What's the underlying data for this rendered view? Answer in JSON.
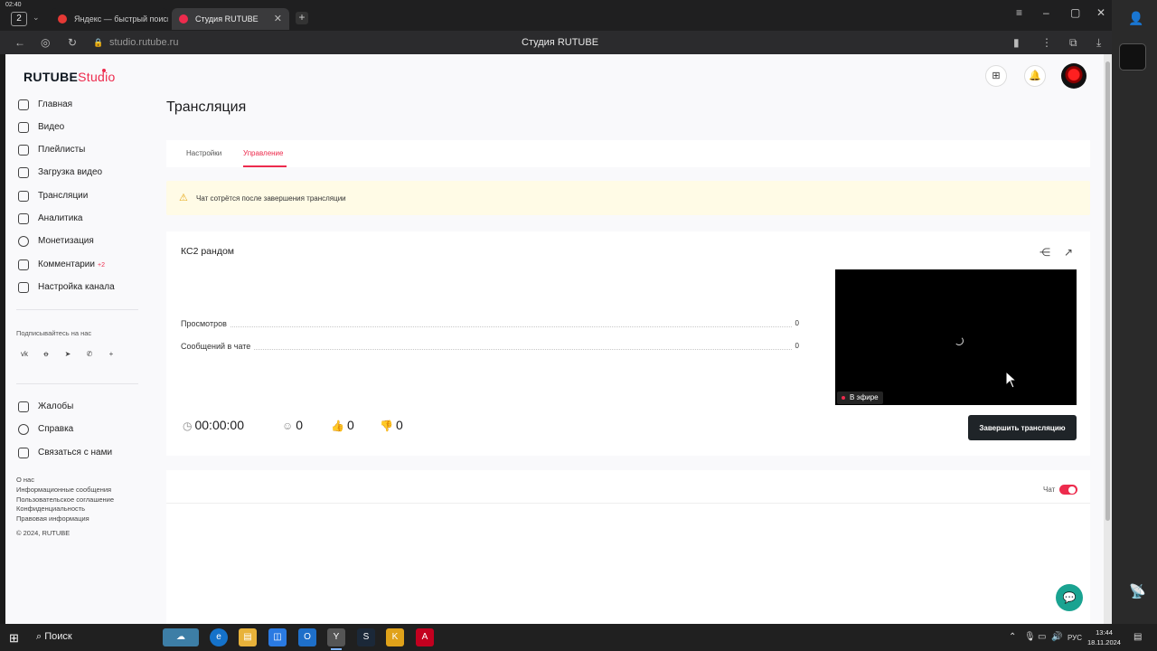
{
  "browser": {
    "recording_time": "02:40",
    "tab_count": "2",
    "tabs": [
      {
        "title": "Яндекс — быстрый поиск",
        "favicon_color": "#e53935"
      },
      {
        "title": "Студия RUTUBE",
        "favicon_color": "#ed2b4d"
      }
    ],
    "new_tab": "+",
    "url": "studio.rutube.ru",
    "page_title": "Студия RUTUBE",
    "nav_icons": [
      "back-icon",
      "shield-icon",
      "reload-icon",
      "lock-icon"
    ],
    "window_controls": [
      "menu-icon",
      "minimize-icon",
      "maximize-icon",
      "close-icon"
    ],
    "toolbar_icons": [
      "bookmark-icon",
      "more-icon",
      "collections-icon",
      "download-icon"
    ]
  },
  "logo": {
    "brand": "RUTUBE",
    "suffix": "Studio"
  },
  "sidebar": {
    "items": [
      {
        "label": "Главная",
        "icon": "home-icon"
      },
      {
        "label": "Видео",
        "icon": "video-icon"
      },
      {
        "label": "Плейлисты",
        "icon": "playlist-icon"
      },
      {
        "label": "Загрузка видео",
        "icon": "upload-icon"
      },
      {
        "label": "Трансляции",
        "icon": "broadcast-icon"
      },
      {
        "label": "Аналитика",
        "icon": "analytics-icon"
      },
      {
        "label": "Монетизация",
        "icon": "monetization-icon"
      },
      {
        "label": "Комментарии",
        "icon": "comments-icon",
        "badge": "+2"
      },
      {
        "label": "Настройка канала",
        "icon": "settings-icon"
      }
    ],
    "follow_label": "Подписывайтесь на нас",
    "socials": [
      "vk-icon",
      "ok-icon",
      "telegram-icon",
      "viber-icon",
      "plus-icon"
    ],
    "secondary_items": [
      {
        "label": "Жалобы",
        "icon": "flag-icon"
      },
      {
        "label": "Справка",
        "icon": "help-icon"
      },
      {
        "label": "Связаться с нами",
        "icon": "contact-icon"
      }
    ],
    "footer_links": [
      "О нас",
      "Информационные сообщения",
      "Пользовательское соглашение",
      "Конфиденциальность",
      "Правовая информация"
    ],
    "copyright": "© 2024, RUTUBE"
  },
  "header": {
    "icons": [
      "add-icon",
      "notifications-icon"
    ],
    "avatar": "avatar"
  },
  "main": {
    "title": "Трансляция",
    "tabs": [
      {
        "label": "Настройки",
        "active": false
      },
      {
        "label": "Управление",
        "active": true
      }
    ],
    "alert_text": "Чат сотрётся после завершения трансляции",
    "stream": {
      "title": "КС2 рандом",
      "stats": [
        {
          "label": "Просмотров",
          "value": "0"
        },
        {
          "label": "Сообщений в чате",
          "value": "0"
        }
      ],
      "live_label": "В эфире",
      "timer": "00:00:00",
      "viewers": "0",
      "likes": "0",
      "dislikes": "0",
      "end_button": "Завершить трансляцию"
    },
    "chat": {
      "label": "Чат",
      "enabled": true
    }
  },
  "taskbar": {
    "search_label": "Поиск",
    "language": "РУС",
    "time": "13:44",
    "date": "18.11.2024"
  },
  "colors": {
    "accent": "#ed2b4d",
    "dark_button": "#1f2428",
    "alert_bg": "#fffbe6",
    "fab": "#1aa391"
  }
}
